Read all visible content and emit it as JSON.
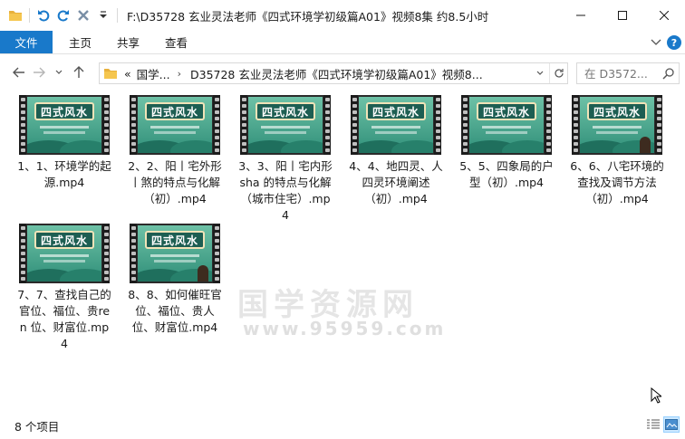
{
  "window": {
    "title": "F:\\D35728 玄业灵法老师《四式环境学初级篇A01》视频8集 约8.5小时"
  },
  "ribbon": {
    "tabs": [
      "文件",
      "主页",
      "共享",
      "查看"
    ]
  },
  "address": {
    "overflow": "«",
    "crumbs": [
      "国学...",
      "D35728 玄业灵法老师《四式环境学初级篇A01》视频8..."
    ]
  },
  "search": {
    "placeholder": "在 D3572..."
  },
  "thumbnail": {
    "banner_text": "四式风水"
  },
  "files": [
    {
      "name": "1、1、环境学的起源.mp4"
    },
    {
      "name": "2、2、阳丨宅外形丨煞的特点与化解（初）.mp4"
    },
    {
      "name": "3、3、阳丨宅内形sha 的特点与化解（城市住宅）.mp4"
    },
    {
      "name": "4、4、地四灵、人四灵环境阐述（初）.mp4"
    },
    {
      "name": "5、5、四象局的户型（初）.mp4"
    },
    {
      "name": "6、6、八宅环境的查找及调节方法（初）.mp4"
    },
    {
      "name": "7、7、查找自己的官位、福位、贵ren 位、财富位.mp4"
    },
    {
      "name": "8、8、如何催旺官位、福位、贵人位、财富位.mp4"
    }
  ],
  "watermark": {
    "line1": "国学资源网",
    "line2": "www.95959.com"
  },
  "status": {
    "count": "8 个项目"
  },
  "colors": {
    "accent": "#1979ca",
    "folder": "#e8b13c"
  }
}
